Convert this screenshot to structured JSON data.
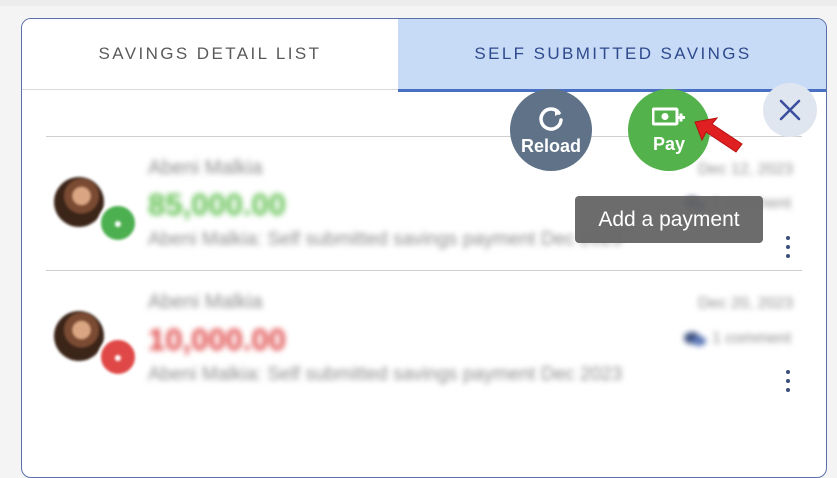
{
  "tabs": [
    {
      "label": "SAVINGS DETAIL LIST",
      "active": false
    },
    {
      "label": "SELF SUBMITTED SAVINGS",
      "active": true
    }
  ],
  "actions": {
    "reload_label": "Reload",
    "pay_label": "Pay",
    "close_icon": "close-icon",
    "tooltip": "Add a payment"
  },
  "records": [
    {
      "name": "Abeni Malkia",
      "amount": "85,000.00",
      "amount_color": "#5fbf4f",
      "status_color": "#4caf50",
      "description": "Abeni Malkia: Self submitted savings payment Dec 2023",
      "date": "Dec 12, 2023",
      "comments": "1 comment"
    },
    {
      "name": "Abeni Malkia",
      "amount": "10,000.00",
      "amount_color": "#e04848",
      "status_color": "#e04848",
      "description": "Abeni Malkia: Self submitted savings payment Dec 2023",
      "date": "Dec 20, 2023",
      "comments": "1 comment"
    }
  ],
  "colors": {
    "accent": "#4a70c4",
    "active_tab_bg": "#c7dbf6",
    "reload_bg": "#5f7287",
    "pay_bg": "#54b24c",
    "annotation_arrow": "#e02020"
  }
}
